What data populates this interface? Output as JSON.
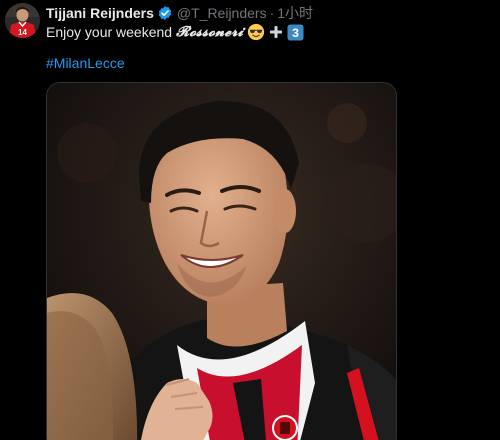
{
  "tweet": {
    "display_name": "Tijjani Reijnders",
    "handle": "@T_Reijnders",
    "separator": "·",
    "time": "1小时",
    "verified": true,
    "avatar_icon": "avatar-photo-icon",
    "avatar_shirt_number": "14",
    "text_prefix": "Enjoy your weekend",
    "text_stylized": "𝓡𝓸𝓼𝓼𝓸𝓷𝓮𝓻𝓲",
    "emojis": [
      "smiling-face-with-sunglasses",
      "heavy-plus-sign",
      "keycap-digit-three"
    ],
    "keycap_digit": "3",
    "hashtag": "#MilanLecce",
    "media_alt": "Smiling player in red and black kit"
  },
  "colors": {
    "background": "#000000",
    "text_primary": "#e7e9ea",
    "text_secondary": "#71767b",
    "link": "#1d9bf0",
    "verified": "#1d9bf0",
    "kit_red": "#e3111b"
  }
}
